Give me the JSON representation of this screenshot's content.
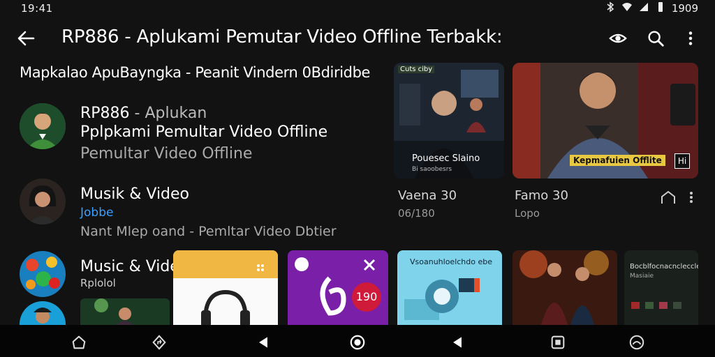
{
  "status_bar": {
    "time": "19:41",
    "battery_text": "1909"
  },
  "app_bar": {
    "title": "RP886 - Aplukami Pemutar Video Offline Terbakk:"
  },
  "subtitle": "Mapkalao ApuBayngka - Peanit Vindern 0Bdiridbe",
  "app_info": {
    "name_main": "RP886",
    "name_rest": " - Aplukan",
    "line2": "Pplpkami Pemultar Video Offline",
    "line3": "Pemultar Video Offline"
  },
  "music_row": {
    "title": "Musik & Video",
    "tag": "Jobbe",
    "desc": "Nant Mlep oand - Pemltar Video Dbtier"
  },
  "music_row_2": {
    "title": "Music & Video",
    "sub": "Rplolol"
  },
  "video_cards": [
    {
      "overlay": "Pouesec Slaino",
      "overlay_sub": "Bi saoobesrs",
      "tag": "Cuts ciby",
      "title": "Vaena 30",
      "sub": "06/180"
    },
    {
      "overlay": "Kepmafuien Offlite",
      "badge": "Hi",
      "title": "Famo 30",
      "sub": "Lopo"
    }
  ],
  "bottom_thumbs": [
    {
      "label": ""
    },
    {
      "label": "190"
    },
    {
      "label": "Vsoanuhloelchdo ebe"
    },
    {
      "label": ""
    },
    {
      "label": "Bocblfocnacncleccleu",
      "sub": "Masiaie"
    }
  ],
  "icons": {
    "back": "arrow-left-icon",
    "eye": "eye-icon",
    "search": "search-icon",
    "more": "more-vertical-icon",
    "card_action": "home-outline-icon",
    "card_more": "more-vertical-icon"
  },
  "colors": {
    "background": "#121212",
    "nav": "#050505",
    "accent": "#3aa0ff"
  }
}
